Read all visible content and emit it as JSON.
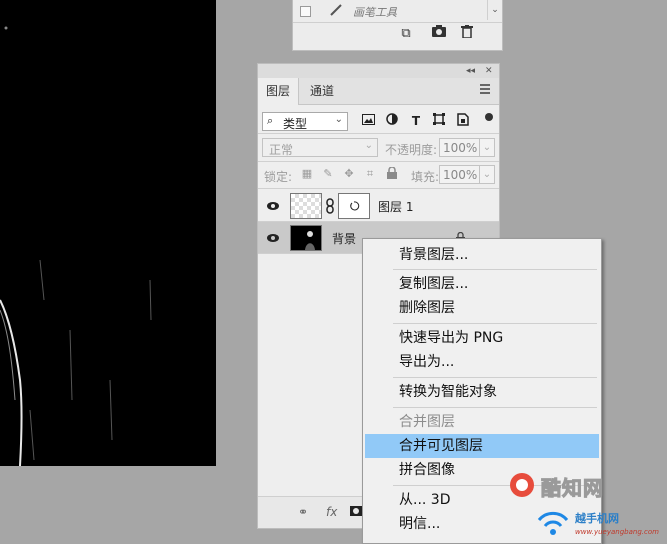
{
  "brush_panel": {
    "item_label": "画笔工具",
    "buttons": [
      "new-preset-icon",
      "camera-icon",
      "trash-icon"
    ]
  },
  "layers_panel": {
    "collapse_label": "◂◂",
    "close_label": "✕",
    "tabs": [
      {
        "label": "图层",
        "active": true
      },
      {
        "label": "通道",
        "active": false
      }
    ],
    "filter": {
      "kind_label": "类型",
      "icons": [
        "image-filter-icon",
        "adjustment-filter-icon",
        "type-filter-icon",
        "shape-filter-icon",
        "smartobject-filter-icon"
      ]
    },
    "blend_mode": "正常",
    "opacity_label": "不透明度:",
    "opacity_value": "100%",
    "lock_label": "锁定:",
    "fill_label": "填充:",
    "fill_value": "100%",
    "layers": [
      {
        "name": "图层 1",
        "visible": true,
        "has_mask": true,
        "selected": false
      },
      {
        "name": "背景",
        "visible": true,
        "locked": true,
        "selected": true
      }
    ],
    "bottom_icons": [
      "link-icon",
      "fx-icon",
      "mask-icon"
    ]
  },
  "context_menu": {
    "items": [
      {
        "label": "背景图层...",
        "state": "normal"
      },
      {
        "sep": true
      },
      {
        "label": "复制图层...",
        "state": "normal"
      },
      {
        "label": "删除图层",
        "state": "normal"
      },
      {
        "sep": true
      },
      {
        "label": "快速导出为 PNG",
        "state": "normal"
      },
      {
        "label": "导出为...",
        "state": "normal"
      },
      {
        "sep": true
      },
      {
        "label": "转换为智能对象",
        "state": "normal"
      },
      {
        "sep": true
      },
      {
        "label": "合并图层",
        "state": "disabled"
      },
      {
        "label": "合并可见图层",
        "state": "highlight"
      },
      {
        "label": "拼合图像",
        "state": "normal"
      },
      {
        "sep": true
      },
      {
        "label": "从... 3D",
        "state": "normal"
      },
      {
        "label": "明信...",
        "state": "normal"
      }
    ],
    "highlight_color": "#91c9f7"
  },
  "watermark": {
    "name": "酷知网",
    "line2": "越手机网",
    "url": "www.yueyangbang.com"
  }
}
